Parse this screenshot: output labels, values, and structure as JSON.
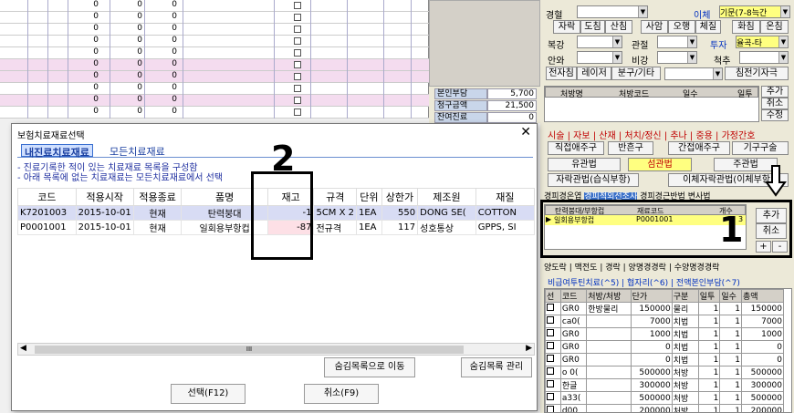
{
  "bg_grid": {
    "rows": [
      {
        "a": "0",
        "b": "0",
        "c": "0"
      },
      {
        "a": "0",
        "b": "0",
        "c": "0"
      },
      {
        "a": "0",
        "b": "0",
        "c": "0"
      },
      {
        "a": "0",
        "b": "0",
        "c": "0"
      },
      {
        "a": "0",
        "b": "0",
        "c": "0"
      },
      {
        "a": "0",
        "b": "0",
        "c": "0"
      },
      {
        "a": "0",
        "b": "0",
        "c": "0"
      },
      {
        "a": "0",
        "b": "0",
        "c": "0"
      },
      {
        "a": "0",
        "b": "0",
        "c": "0"
      },
      {
        "a": "0",
        "b": "0",
        "c": "0"
      }
    ]
  },
  "summary": {
    "rows": [
      {
        "label": "본인부담",
        "value": "5,700"
      },
      {
        "label": "청구금액",
        "value": "21,500"
      },
      {
        "label": "잔여진료",
        "value": "0"
      }
    ]
  },
  "right": {
    "row1": {
      "label": "경혈",
      "ilche": "이체",
      "combo": "기문(7-8늑간"
    },
    "row2": [
      "자락",
      "도침",
      "산침",
      "사암",
      "오행",
      "체질",
      "화침",
      "온침"
    ],
    "row3": {
      "label": "복강",
      "label2": "관절",
      "label3": "투자",
      "combo": "율곡-타"
    },
    "row4": {
      "label": "안와",
      "label2": "비강",
      "label3": "척추"
    },
    "row5": {
      "btn1": "전자침",
      "btn2": "레이저",
      "btn3": "분구/기타",
      "btn4": "침전기자극"
    },
    "grid_hdr": [
      "처방명",
      "처방코드",
      "일수",
      "일투"
    ],
    "side_btns": [
      "추가",
      "취소",
      "수정"
    ],
    "tabs": [
      "시술",
      "자보",
      "산재",
      "처치/정신",
      "추나",
      "중용",
      "가정간호"
    ],
    "btns_a": [
      "직접애주구",
      "반흔구",
      "간접애주구",
      "기구구술"
    ],
    "btns_b": [
      "유관법",
      "섬관법",
      "주관법"
    ],
    "btns_c": [
      "자락관법(습식부항)",
      "이체자락관법(이체부항)"
    ],
    "tabs2": [
      "경피경온엽",
      "경피적외선조사",
      "경피경근반법",
      "변사법"
    ],
    "small_hdr": [
      "탄력붕대/부항컵",
      "재료코드",
      "개수"
    ],
    "small_row": {
      "name": "일회용부항컵",
      "code": "P0001001",
      "count": "3"
    },
    "small_btns": [
      "추가",
      "취소",
      "+",
      "-"
    ],
    "tabs3": [
      "양도락",
      "맥전도",
      "경락",
      "양명경경락",
      "수양명경경락"
    ],
    "tabs4": [
      "비급여투틴치료(^5)",
      "협자리(^6)",
      "전액본인부담(^7)"
    ],
    "bottom_hdr": [
      "선",
      "코드",
      "처방/처방",
      "단가",
      "구분",
      "일투",
      "일수",
      "총액"
    ],
    "bottom_rows": [
      {
        "code": "GR0",
        "name": "한방물리",
        "price": "150000",
        "type": "물리",
        "d": "1",
        "n": "1",
        "total": "150000"
      },
      {
        "code": "ca0(",
        "name": "",
        "price": "7000",
        "type": "치법",
        "d": "1",
        "n": "1",
        "total": "7000"
      },
      {
        "code": "GR0",
        "name": "",
        "price": "1000",
        "type": "치법",
        "d": "1",
        "n": "1",
        "total": "1000"
      },
      {
        "code": "GR0",
        "name": "",
        "price": "0",
        "type": "치법",
        "d": "1",
        "n": "1",
        "total": "0"
      },
      {
        "code": "GR0",
        "name": "",
        "price": "0",
        "type": "치법",
        "d": "1",
        "n": "1",
        "total": "0"
      },
      {
        "code": "o 0(",
        "name": "",
        "price": "500000",
        "type": "처방",
        "d": "1",
        "n": "1",
        "total": "500000"
      },
      {
        "code": "한글",
        "name": "",
        "price": "300000",
        "type": "처방",
        "d": "1",
        "n": "1",
        "total": "300000"
      },
      {
        "code": "a33(",
        "name": "",
        "price": "500000",
        "type": "처방",
        "d": "1",
        "n": "1",
        "total": "500000"
      },
      {
        "code": "d00",
        "name": "",
        "price": "200000",
        "type": "처방",
        "d": "1",
        "n": "1",
        "total": "200000"
      }
    ]
  },
  "annotations": {
    "n1": "1",
    "n2": "2"
  },
  "dialog": {
    "title": "보험치료재료선택",
    "close": "✕",
    "tab_active": "내진료치료재료",
    "tab_other": "모든치료재료",
    "note1": "- 진료기록한 적이 있는 치료재료 목록을 구성함",
    "note2": "- 아래 목록에 없는 치료재료는 모든치료재료에서 선택",
    "columns": [
      "코드",
      "적용시작",
      "적용종료",
      "품명",
      "재고",
      "규격",
      "단위",
      "상한가",
      "제조원",
      "재질"
    ],
    "rows": [
      {
        "code": "K7201003",
        "start": "2015-10-01",
        "end": "현재",
        "name": "탄력붕대",
        "stock": "-1",
        "spec": "5CM X 2",
        "unit": "1EA",
        "price": "550",
        "maker": "DONG SE(",
        "material": "COTTON"
      },
      {
        "code": "P0001001",
        "start": "2015-10-01",
        "end": "현재",
        "name": "일회용부항컵",
        "stock": "-87",
        "spec": "전규격",
        "unit": "1EA",
        "price": "117",
        "maker": "성호통상",
        "material": "GPPS, SI"
      }
    ],
    "btn_move": "숨김목록으로 이동",
    "btn_manage": "숨김목록 관리",
    "btn_select": "선택(F12)",
    "btn_cancel": "취소(F9)",
    "scroll_mid": "III"
  }
}
